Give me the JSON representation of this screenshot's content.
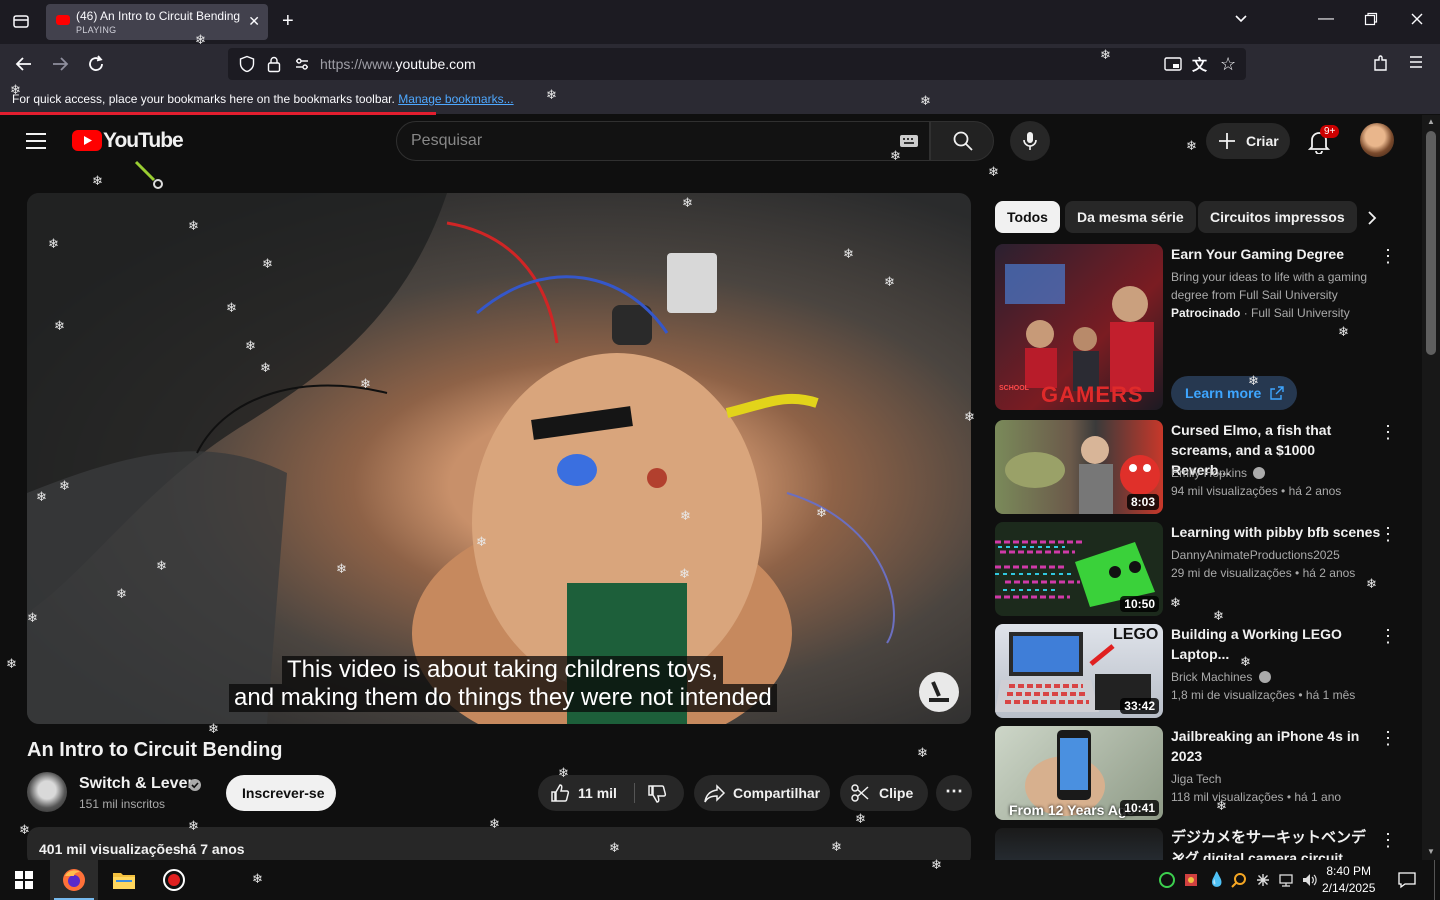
{
  "browser": {
    "tab_title": "(46) An Intro to Circuit Bending",
    "tab_status": "PLAYING",
    "url_prefix": "https://www.",
    "url_domain": "youtube.com",
    "bookmarks_message": "For quick access, place your bookmarks here on the bookmarks toolbar.",
    "manage_bookmarks": "Manage bookmarks..."
  },
  "youtube": {
    "logo_text": "YouTube",
    "search_placeholder": "Pesquisar",
    "create_label": "Criar",
    "notifications_badge": "9+",
    "brand_color": "#ff0000"
  },
  "video": {
    "caption_line1": "This video is about taking childrens toys,",
    "caption_line2": "and making them do things they were not intended",
    "title": "An Intro to Circuit Bending",
    "channel": "Switch & Lever",
    "subscribers": "151 mil inscritos",
    "subscribe_label": "Inscrever-se",
    "likes": "11 mil",
    "share_label": "Compartilhar",
    "clip_label": "Clipe",
    "views": "401 mil visualizações",
    "age": "há 7 anos"
  },
  "chips": [
    "Todos",
    "Da mesma série",
    "Circuitos impressos"
  ],
  "ad": {
    "title": "Earn Your Gaming Degree",
    "desc1": "Bring your ideas to life with a gaming",
    "desc2": "degree from Full Sail University",
    "sponsored": "Patrocinado",
    "advertiser": "· Full Sail University",
    "learn_more": "Learn more"
  },
  "recommendations": [
    {
      "title1": "Cursed Elmo, a fish that",
      "title2": "screams, and a $1000 Reverb...",
      "channel": "Emily Hopkins",
      "verified": true,
      "meta": "94 mil visualizações  • há 2 anos",
      "duration": "8:03"
    },
    {
      "title1": "Learning with pibby bfb scenes",
      "title2": "",
      "channel": "DannyAnimateProductions2025",
      "verified": false,
      "meta": "29 mi de visualizações  • há 2 anos",
      "duration": "10:50"
    },
    {
      "title1": "Building a Working LEGO",
      "title2": "Laptop...",
      "channel": "Brick Machines",
      "verified": true,
      "meta": "1,8 mi de visualizações  • há 1 mês",
      "duration": "33:42"
    },
    {
      "title1": "Jailbreaking an iPhone 4s in",
      "title2": "2023",
      "channel": "Jiga Tech",
      "verified": false,
      "meta": "118 mil visualizações  • há 1 ano",
      "duration": "10:41"
    },
    {
      "title1": "デジカメをサーキットベンディ",
      "title2": "ング digital camera circuit",
      "channel": "",
      "verified": false,
      "meta": "",
      "duration": ""
    }
  ],
  "thumb_text": {
    "ad_school": "SCHOOL",
    "ad_gamers": "GAMERS",
    "lego_label": "LEGO",
    "iphone_label": "From 12 Years Ago"
  },
  "taskbar": {
    "time": "8:40 PM",
    "date": "2/14/2025"
  }
}
